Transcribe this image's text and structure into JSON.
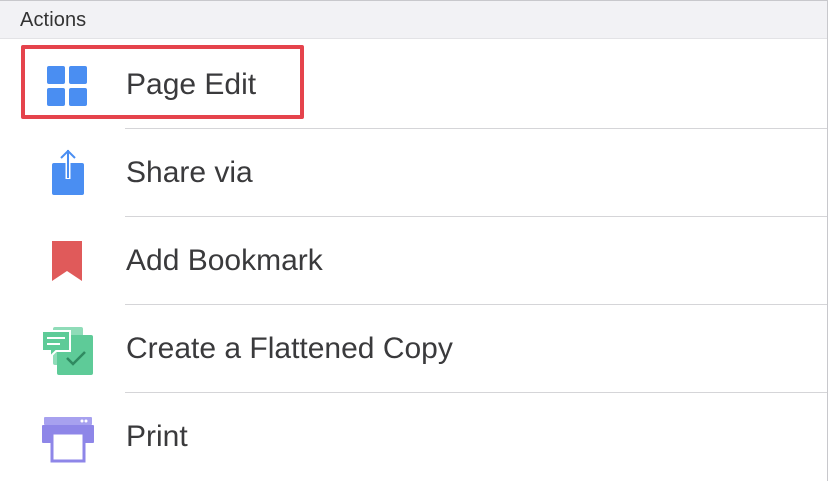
{
  "section": {
    "title": "Actions"
  },
  "actions": [
    {
      "label": "Page Edit",
      "icon": "grid-icon",
      "color": "#4a8ef2"
    },
    {
      "label": "Share via",
      "icon": "share-icon",
      "color": "#4a8ef2"
    },
    {
      "label": "Add Bookmark",
      "icon": "bookmark-icon",
      "color": "#e05a5a"
    },
    {
      "label": "Create a Flattened Copy",
      "icon": "flatten-copy-icon",
      "color": "#5ecb98"
    },
    {
      "label": "Print",
      "icon": "printer-icon",
      "color": "#8e86e8"
    }
  ],
  "highlight_color": "#e5434c"
}
